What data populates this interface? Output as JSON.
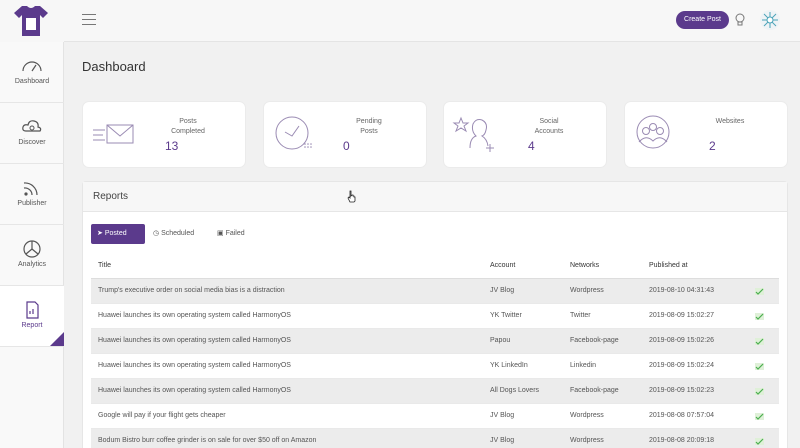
{
  "header": {
    "create_label": "Create Post"
  },
  "sidebar": {
    "items": [
      {
        "label": "Dashboard"
      },
      {
        "label": "Discover"
      },
      {
        "label": "Publisher"
      },
      {
        "label": "Analytics"
      },
      {
        "label": "Report"
      }
    ]
  },
  "page": {
    "title": "Dashboard"
  },
  "stats": [
    {
      "label1": "Posts",
      "label2": "Completed",
      "value": "13"
    },
    {
      "label1": "Pending",
      "label2": "Posts",
      "value": "0"
    },
    {
      "label1": "Social",
      "label2": "Accounts",
      "value": "4"
    },
    {
      "label1": "Websites",
      "label2": "",
      "value": "2"
    }
  ],
  "reports": {
    "title": "Reports",
    "tabs": [
      {
        "label": "Posted"
      },
      {
        "label": "Scheduled"
      },
      {
        "label": "Failed"
      }
    ],
    "columns": [
      "Title",
      "Account",
      "Networks",
      "Published at"
    ],
    "rows": [
      {
        "title": "Trump's executive order on social media bias is a distraction",
        "account": "JV Blog",
        "network": "Wordpress",
        "published": "2019-08-10 04:31:43"
      },
      {
        "title": "Huawei launches its own operating system called HarmonyOS",
        "account": "YK Twitter",
        "network": "Twitter",
        "published": "2019-08-09 15:02:27"
      },
      {
        "title": "Huawei launches its own operating system called HarmonyOS",
        "account": "Papou",
        "network": "Facebook-page",
        "published": "2019-08-09 15:02:26"
      },
      {
        "title": "Huawei launches its own operating system called HarmonyOS",
        "account": "YK LinkedIn",
        "network": "Linkedin",
        "published": "2019-08-09 15:02:24"
      },
      {
        "title": "Huawei launches its own operating system called HarmonyOS",
        "account": "All Dogs Lovers",
        "network": "Facebook-page",
        "published": "2019-08-09 15:02:23"
      },
      {
        "title": "Google will pay if your flight gets cheaper",
        "account": "JV Blog",
        "network": "Wordpress",
        "published": "2019-08-08 07:57:04"
      },
      {
        "title": "Bodum Bistro burr coffee grinder is on sale for over $50 off on Amazon",
        "account": "JV Blog",
        "network": "Wordpress",
        "published": "2019-08-08 20:09:18"
      }
    ]
  },
  "icons": {
    "logo": "tshirt-logo-icon",
    "menu": "hamburger-menu-icon",
    "bulb": "lightbulb-icon",
    "avatar": "user-avatar-icon",
    "row_status": "success-check-icon"
  },
  "colors": {
    "accent": "#5b3a8c",
    "status": "#4caf50"
  }
}
